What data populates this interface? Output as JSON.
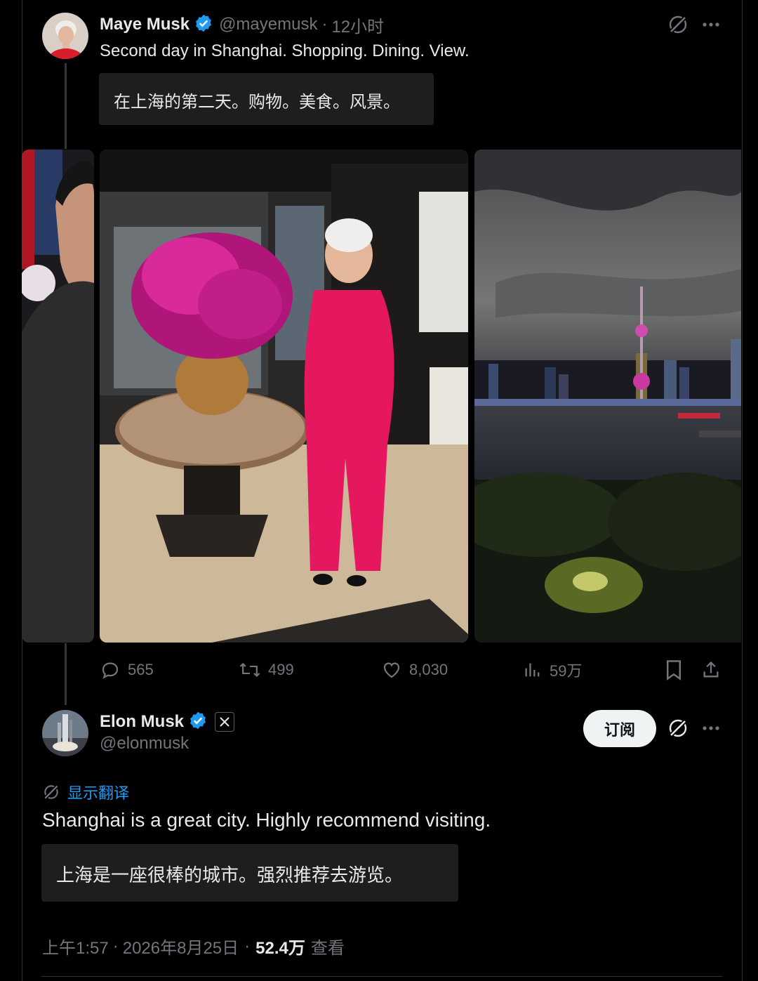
{
  "tweet1": {
    "author_name": "Maye Musk",
    "handle": "@mayemusk",
    "time": "12小时",
    "text": "Second day in Shanghai. Shopping. Dining. View.",
    "translation": "在上海的第二天。购物。美食。风景。",
    "stats": {
      "replies": "565",
      "retweets": "499",
      "likes": "8,030",
      "views": "59万"
    }
  },
  "tweet2": {
    "author_name": "Elon Musk",
    "handle": "@elonmusk",
    "subscribe_label": "订阅",
    "show_translation": "显示翻译",
    "text": "Shanghai is a great city. Highly recommend visiting.",
    "translation": "上海是一座很棒的城市。强烈推荐去游览。",
    "time": "上午1:57",
    "date": "2026年8月25日",
    "views_count": "52.4万",
    "views_label": "查看"
  },
  "colors": {
    "background": "#000000",
    "text": "#e7e9ea",
    "muted": "#71767b",
    "verified": "#1d9bf0",
    "translation_box": "#1e1e1e",
    "link": "#1d9bf0"
  }
}
